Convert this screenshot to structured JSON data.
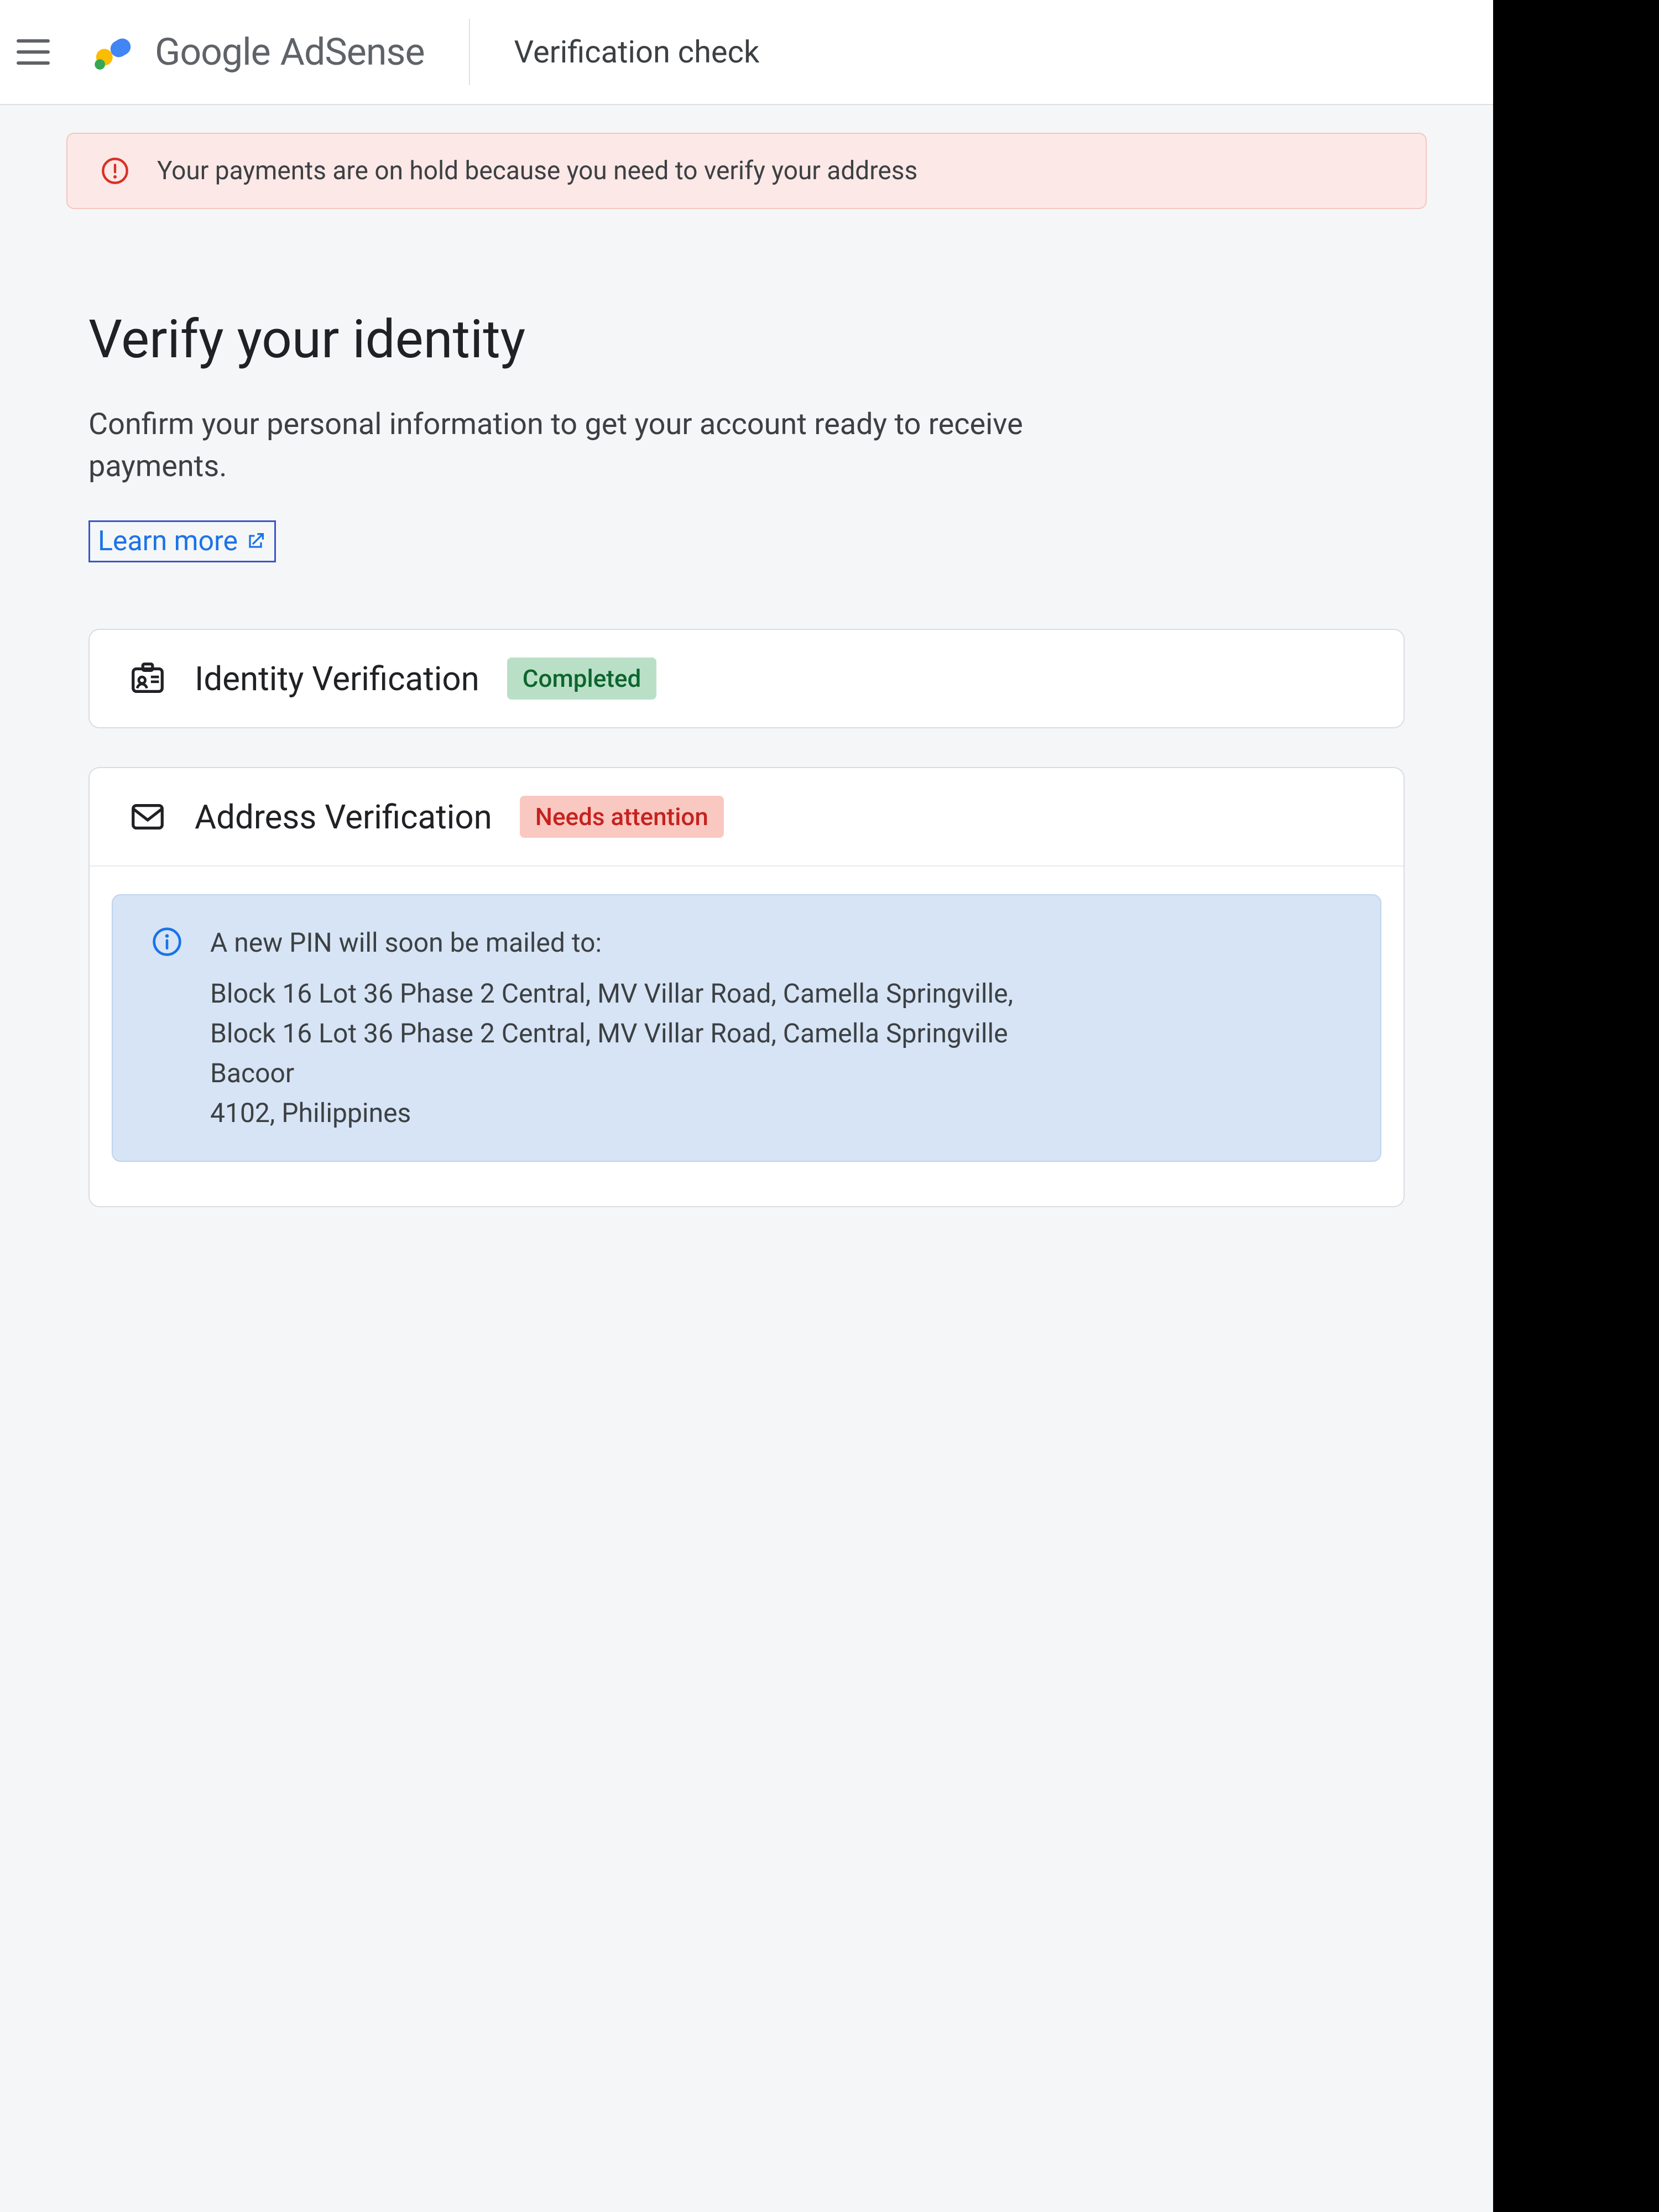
{
  "header": {
    "product_google": "Google",
    "product_adsense": "AdSense",
    "page": "Verification check"
  },
  "alert": {
    "text": "Your payments are on hold because you need to verify your address"
  },
  "main": {
    "title": "Verify your identity",
    "subtitle": "Confirm your personal information to get your account ready to receive payments.",
    "learn_more": "Learn more"
  },
  "cards": {
    "identity": {
      "title": "Identity Verification",
      "status": "Completed"
    },
    "address": {
      "title": "Address Verification",
      "status": "Needs attention",
      "info_lead": "A new PIN will soon be mailed to:",
      "addr_line1": "Block 16 Lot 36 Phase 2 Central, MV Villar Road, Camella Springville,",
      "addr_line2": "Block 16 Lot 36 Phase 2 Central, MV Villar Road, Camella Springville",
      "addr_city": "Bacoor",
      "addr_postal_country": "4102, Philippines"
    }
  },
  "colors": {
    "brand_yellow": "#fbbc04",
    "brand_green": "#34a853",
    "brand_blue": "#4285f4",
    "error": "#d93025",
    "info": "#1a73e8"
  }
}
